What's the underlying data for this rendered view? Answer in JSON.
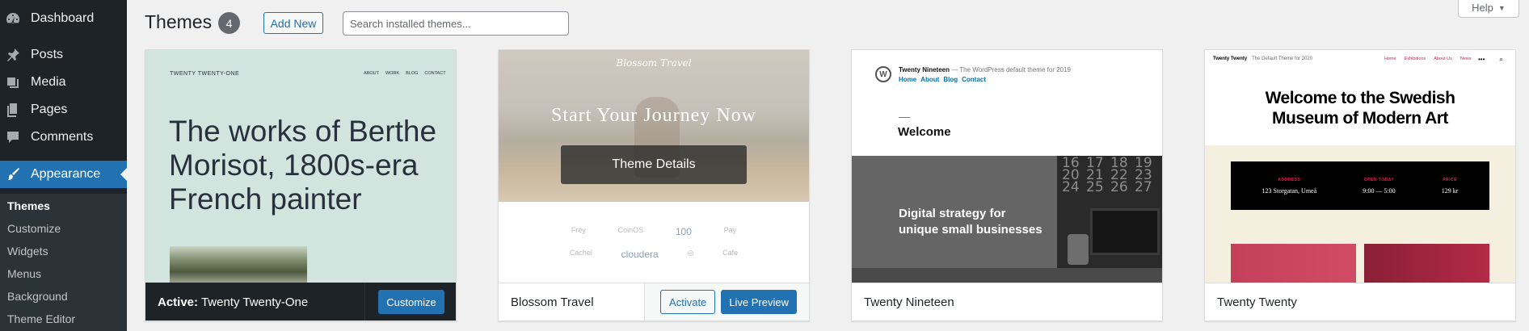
{
  "sidebar": {
    "items": [
      {
        "label": "Dashboard",
        "icon": "dashboard-icon"
      },
      {
        "label": "Posts",
        "icon": "pin-icon"
      },
      {
        "label": "Media",
        "icon": "media-icon"
      },
      {
        "label": "Pages",
        "icon": "pages-icon"
      },
      {
        "label": "Comments",
        "icon": "comment-icon"
      },
      {
        "label": "Appearance",
        "icon": "paintbrush-icon",
        "active": true
      }
    ],
    "submenu": [
      "Themes",
      "Customize",
      "Widgets",
      "Menus",
      "Background",
      "Theme Editor"
    ],
    "submenu_current": "Themes"
  },
  "header": {
    "title": "Themes",
    "count": "4",
    "add_new_label": "Add New",
    "search_placeholder": "Search installed themes...",
    "help_label": "Help"
  },
  "themes": [
    {
      "name": "Twenty Twenty-One",
      "active_prefix": "Active:",
      "customize_label": "Customize",
      "preview": {
        "brand": "TWENTY TWENTY-ONE",
        "nav": [
          "ABOUT",
          "WORK",
          "BLOG",
          "CONTACT"
        ],
        "heading": "The works of Berthe Morisot, 1800s-era French painter"
      }
    },
    {
      "name": "Blossom Travel",
      "activate_label": "Activate",
      "live_preview_label": "Live Preview",
      "overlay_label": "Theme Details",
      "preview": {
        "logo": "Blossom Travel",
        "hero": "Start Your Journey Now",
        "logos_row1": [
          "Frey",
          "CoinOS",
          "100",
          "Pay"
        ],
        "logos_row2": [
          "Cachel",
          "cloudera",
          "◎",
          "Cafe"
        ]
      }
    },
    {
      "name": "Twenty Nineteen",
      "preview": {
        "site_title": "Twenty Nineteen",
        "tagline": "— The WordPress default theme for 2019",
        "nav": [
          "Home",
          "About",
          "Blog",
          "Contact"
        ],
        "welcome": "Welcome",
        "band_text_1": "Digital strategy for",
        "band_text_2": "unique small businesses",
        "calendar": [
          "16",
          "17",
          "18",
          "19",
          "20",
          "21",
          "22",
          "23",
          "24",
          "25",
          "26",
          "27"
        ]
      }
    },
    {
      "name": "Twenty Twenty",
      "preview": {
        "brand": "Twenty Twenty",
        "tagline": "The Default Theme for 2020",
        "nav": [
          "Home",
          "Exhibitions",
          "About Us",
          "News"
        ],
        "heading_1": "Welcome to the Swedish",
        "heading_2": "Museum of Modern Art",
        "info": [
          {
            "k": "ADDRESS",
            "v": "123 Storgatan, Umeå"
          },
          {
            "k": "OPEN TODAY",
            "v": "9:00 — 5:00"
          },
          {
            "k": "PRICE",
            "v": "129 kr"
          }
        ]
      }
    }
  ],
  "colors": {
    "sidebar_bg": "#1d2327",
    "accent": "#2271b1",
    "page_bg": "#f0f0f1"
  }
}
